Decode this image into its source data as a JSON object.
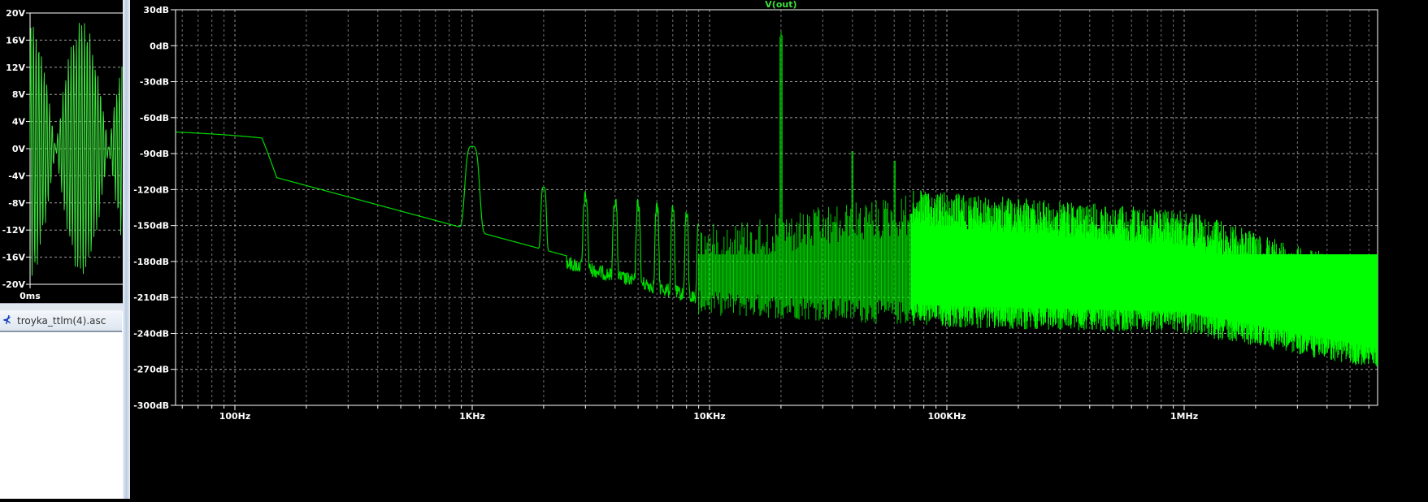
{
  "waveform_pane": {
    "y_ticks": [
      "20V",
      "16V",
      "12V",
      "8V",
      "4V",
      "0V",
      "-4V",
      "-8V",
      "-12V",
      "-16V",
      "-20V"
    ],
    "x_tick": "0ms"
  },
  "file_tab": {
    "label": "troyka_ttlm(4).asc",
    "icon": "transistor-schematic-icon"
  },
  "colors": {
    "trace": "#00ff00",
    "background": "#000000",
    "grid": "#a0a0a0",
    "axis": "#ffffff"
  },
  "chart_data": {
    "type": "line",
    "title": "V(out)",
    "xscale": "log",
    "xlim_hz": [
      56,
      6460000
    ],
    "ylim_db": [
      -300,
      30
    ],
    "y_ticks": [
      "30dB",
      "0dB",
      "-30dB",
      "-60dB",
      "-90dB",
      "-120dB",
      "-150dB",
      "-180dB",
      "-210dB",
      "-240dB",
      "-270dB",
      "-300dB"
    ],
    "x_ticks": [
      "100Hz",
      "1KHz",
      "10KHz",
      "100KHz",
      "1MHz"
    ],
    "grid": true,
    "series": [
      {
        "name": "V(out)",
        "description_points_db": [
          {
            "f": 56,
            "db": -72
          },
          {
            "f": 100,
            "db": -74
          },
          {
            "f": 130,
            "db": -85
          },
          {
            "f": 150,
            "db": -110
          },
          {
            "f": 850,
            "db": -149
          },
          {
            "f": 1000,
            "db": -84
          },
          {
            "f": 1150,
            "db": -157
          },
          {
            "f": 1900,
            "db": -170
          },
          {
            "f": 2000,
            "db": -118
          },
          {
            "f": 3000,
            "db": -120
          },
          {
            "f": 4000,
            "db": -124
          },
          {
            "f": 5000,
            "db": -129
          },
          {
            "f": 20000,
            "db": 16
          },
          {
            "f": 40000,
            "db": -88
          },
          {
            "f": 60000,
            "db": -96
          },
          {
            "f": 100000,
            "db": -105
          },
          {
            "f": 1000000,
            "db": -130
          },
          {
            "f": 6460000,
            "db": -200
          }
        ],
        "noise_floor_db": [
          {
            "f": 10000,
            "db": -215
          },
          {
            "f": 100000,
            "db": -225
          },
          {
            "f": 1000000,
            "db": -230
          },
          {
            "f": 6460000,
            "db": -260
          }
        ]
      }
    ]
  }
}
